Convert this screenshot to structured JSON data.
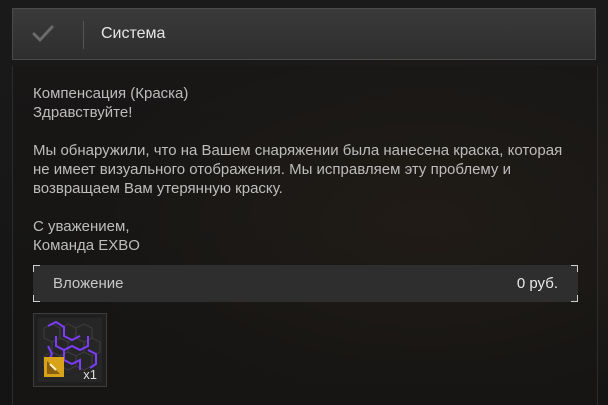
{
  "header": {
    "title": "Система",
    "check_icon": "checkmark-icon"
  },
  "message": {
    "subject": "Компенсация (Краска)",
    "greeting": "Здравствуйте!",
    "paragraph": "Мы обнаружили, что на Вашем снаряжении была нанесена краска, которая не имеет визуального отображения. Мы исправляем эту проблему и возвращаем Вам утерянную краску.",
    "closing": "С уважением,",
    "signature": "Команда EXBO"
  },
  "attachment": {
    "label": "Вложение",
    "price": "0 руб."
  },
  "item": {
    "icon": "paint-item-icon",
    "quantity": "x1"
  },
  "colors": {
    "accent_purple": "#7b3cff",
    "badge_yellow": "#d9a21b"
  }
}
